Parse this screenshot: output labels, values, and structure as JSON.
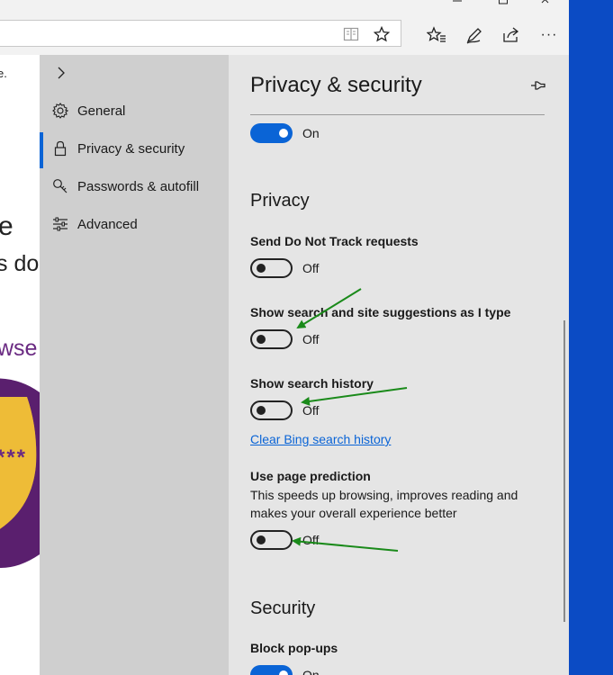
{
  "toolbar": {
    "icons": [
      "reading-view-icon",
      "favorite-star-icon",
      "favorites-hub-icon",
      "pen-icon",
      "share-icon",
      "more-icon"
    ],
    "more_glyph": "···"
  },
  "webpage": {
    "fragment_1": "e.",
    "fragment_2": "e",
    "fragment_3": "s do",
    "fragment_4": "wse",
    "fragment_5": "***"
  },
  "nav": {
    "items": [
      {
        "label": "General",
        "icon": "gear-icon"
      },
      {
        "label": "Privacy & security",
        "icon": "lock-icon"
      },
      {
        "label": "Passwords & autofill",
        "icon": "key-icon"
      },
      {
        "label": "Advanced",
        "icon": "sliders-icon"
      }
    ]
  },
  "panel": {
    "title": "Privacy & security",
    "top_toggle": {
      "state": "On",
      "on": true
    },
    "privacy_heading": "Privacy",
    "settings": [
      {
        "label": "Send Do Not Track requests",
        "state": "Off",
        "on": false
      },
      {
        "label": "Show search and site suggestions as I type",
        "state": "Off",
        "on": false
      },
      {
        "label": "Show search history",
        "state": "Off",
        "on": false
      },
      {
        "label": "Use page prediction",
        "description": "This speeds up browsing, improves reading and makes your overall experience better",
        "state": "Off",
        "on": false
      }
    ],
    "clear_link": "Clear Bing search history",
    "security_heading": "Security",
    "block_popups": {
      "label": "Block pop-ups",
      "state": "On",
      "on": true
    }
  },
  "colors": {
    "accent": "#0a64d6",
    "nav_bg": "#cfcfcf",
    "panel_bg": "#e5e5e5",
    "annotation_arrow": "#1a8a1a",
    "desktop": "#0b4bc4"
  }
}
